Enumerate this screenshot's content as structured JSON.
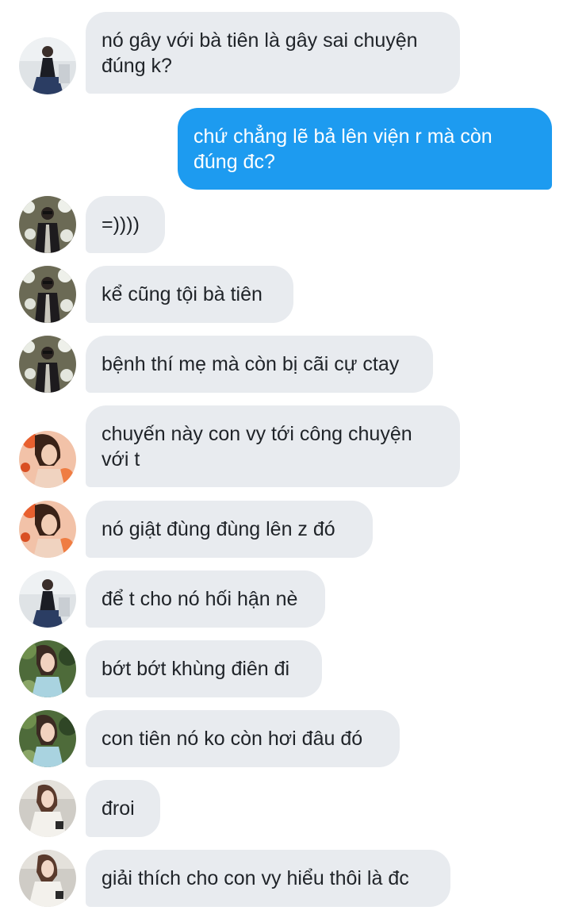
{
  "conversation": {
    "messages": [
      {
        "sender": "girl-black-dress",
        "text": "nó gây với bà tiên là gây sai chuyện đúng k?"
      },
      {
        "sender": "me",
        "text": "chứ chẳng lẽ bả lên viện r mà còn đúng đc?"
      },
      {
        "sender": "guy-flowers",
        "text": "=))))"
      },
      {
        "sender": "guy-flowers",
        "text": "kể cũng tội bà tiên"
      },
      {
        "sender": "guy-flowers",
        "text": "bệnh thí mẹ mà còn bị cãi cự ctay"
      },
      {
        "sender": "girl-orange",
        "text": "chuyến này con vy tới công chuyện với t"
      },
      {
        "sender": "girl-orange",
        "text": "nó giật đùng đùng lên z đó"
      },
      {
        "sender": "girl-black-dress",
        "text": "để t cho nó hối hận nè"
      },
      {
        "sender": "girl-green",
        "text": "bớt bớt khùng điên đi"
      },
      {
        "sender": "girl-green",
        "text": "con tiên nó ko còn hơi đâu đó"
      },
      {
        "sender": "girl-white-coat",
        "text": "đroi"
      },
      {
        "sender": "girl-white-coat",
        "text": "giải thích cho con vy hiểu thôi là đc"
      }
    ]
  },
  "colors": {
    "incoming_bubble": "#e8ebef",
    "incoming_text": "#1f2328",
    "outgoing_bubble": "#1d9bf0",
    "outgoing_text": "#ffffff"
  }
}
